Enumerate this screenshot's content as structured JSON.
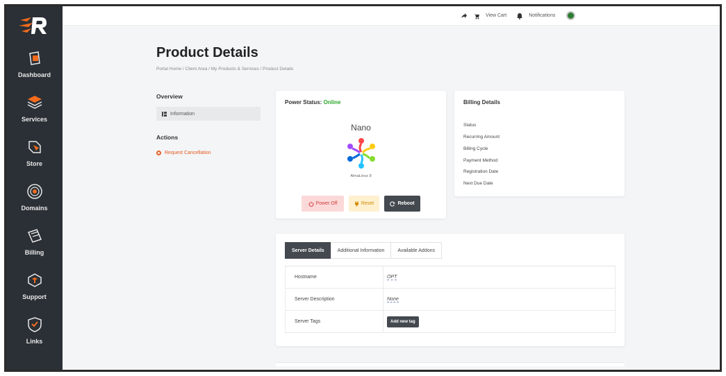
{
  "topbar": {
    "view_cart": "View Cart",
    "notifications": "Notifications"
  },
  "sidebar": {
    "items": [
      {
        "label": "Dashboard",
        "icon": "dashboard-icon"
      },
      {
        "label": "Services",
        "icon": "services-icon"
      },
      {
        "label": "Store",
        "icon": "store-icon"
      },
      {
        "label": "Domains",
        "icon": "domains-icon"
      },
      {
        "label": "Billing",
        "icon": "billing-icon"
      },
      {
        "label": "Support",
        "icon": "support-icon"
      },
      {
        "label": "Links",
        "icon": "links-icon"
      }
    ]
  },
  "page": {
    "title": "Product Details",
    "breadcrumb": "Portal Home  /  Client Area  /  My Products & Services  /  Product Details"
  },
  "side": {
    "overview": "Overview",
    "information": "Information",
    "actions": "Actions",
    "request_cancellation": "Request Cancellation"
  },
  "power": {
    "label": "Power Status:",
    "status": "Online",
    "plan": "Nano",
    "os": "AlmaLinux 8",
    "power_off": "Power Off",
    "reset": "Reset",
    "reboot": "Reboot"
  },
  "billing": {
    "title": "Billing Details",
    "rows": [
      "Status",
      "Recurring Amount",
      "Billing Cycle",
      "Payment Method",
      "Registration Date",
      "Next Due Date"
    ]
  },
  "details": {
    "tabs": [
      "Server Details",
      "Additional Information",
      "Available Addons"
    ],
    "hostname_label": "Hostname",
    "hostname_value": "OPT",
    "description_label": "Server Description",
    "description_value": "None",
    "tags_label": "Server Tags",
    "add_tag": "Add new tag"
  },
  "colors": {
    "sidebar": "#2b3036",
    "accent": "#e25a1c",
    "online": "#2ea82e",
    "dark_button": "#44494f"
  }
}
